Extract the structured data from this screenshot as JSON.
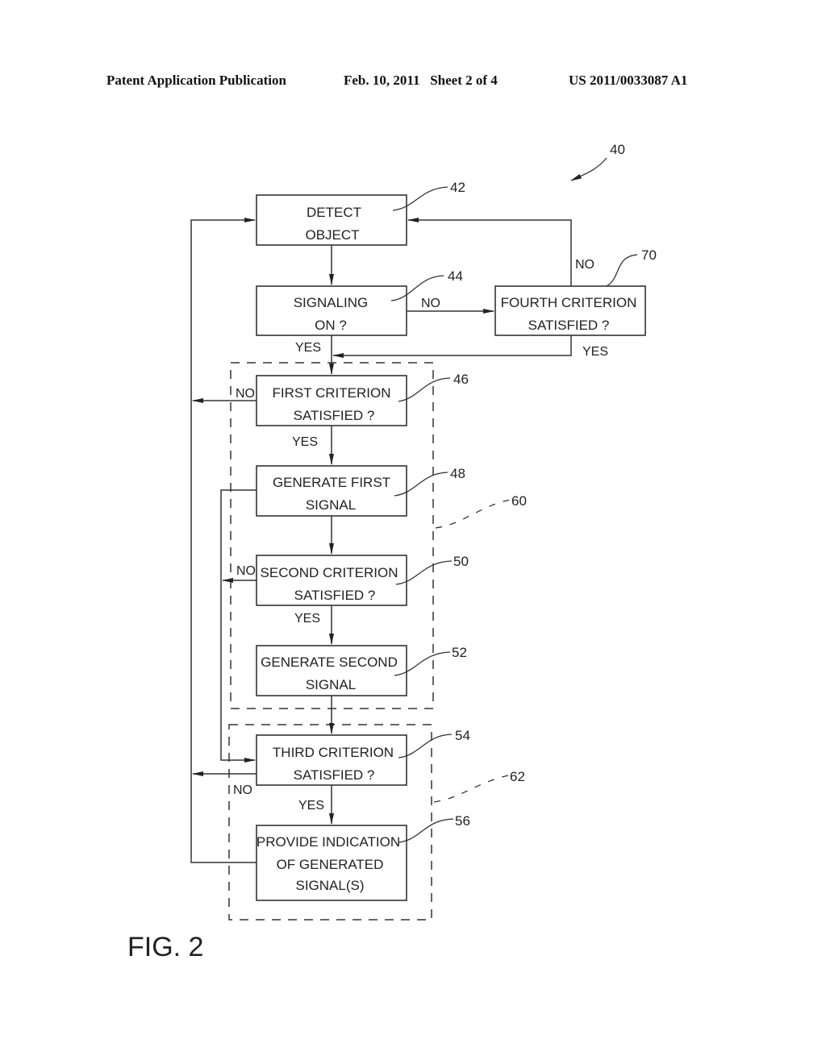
{
  "header": {
    "publication": "Patent Application Publication",
    "date_sheet": "Feb. 10, 2011   Sheet 2 of 4",
    "number": "US 2011/0033087 A1"
  },
  "figure": {
    "label": "FIG. 2",
    "ref": "40"
  },
  "boxes": {
    "detect": {
      "ref": "42",
      "line1": "DETECT",
      "line2": "OBJECT"
    },
    "signaling": {
      "ref": "44",
      "line1": "SIGNALING",
      "line2": "ON ?"
    },
    "fourth": {
      "ref": "70",
      "line1": "FOURTH CRITERION",
      "line2": "SATISFIED ?"
    },
    "first": {
      "ref": "46",
      "line1": "FIRST CRITERION",
      "line2": "SATISFIED ?"
    },
    "gen_first": {
      "ref": "48",
      "line1": "GENERATE FIRST",
      "line2": "SIGNAL"
    },
    "second": {
      "ref": "50",
      "line1": "SECOND CRITERION",
      "line2": "SATISFIED ?"
    },
    "gen_second": {
      "ref": "52",
      "line1": "GENERATE SECOND",
      "line2": "SIGNAL"
    },
    "third": {
      "ref": "54",
      "line1": "THIRD CRITERION",
      "line2": "SATISFIED ?"
    },
    "provide": {
      "ref": "56",
      "line1": "PROVIDE INDICATION",
      "line2": "OF GENERATED",
      "line3": "SIGNAL(S)"
    }
  },
  "groups": {
    "group60": {
      "ref": "60"
    },
    "group62": {
      "ref": "62"
    }
  },
  "edge_labels": {
    "signaling_no": "NO",
    "signaling_yes": "YES",
    "fourth_no": "NO",
    "fourth_yes": "YES",
    "first_no": "NO",
    "first_yes": "YES",
    "second_no": "NO",
    "second_yes": "YES",
    "third_no": "NO",
    "third_yes": "YES"
  }
}
